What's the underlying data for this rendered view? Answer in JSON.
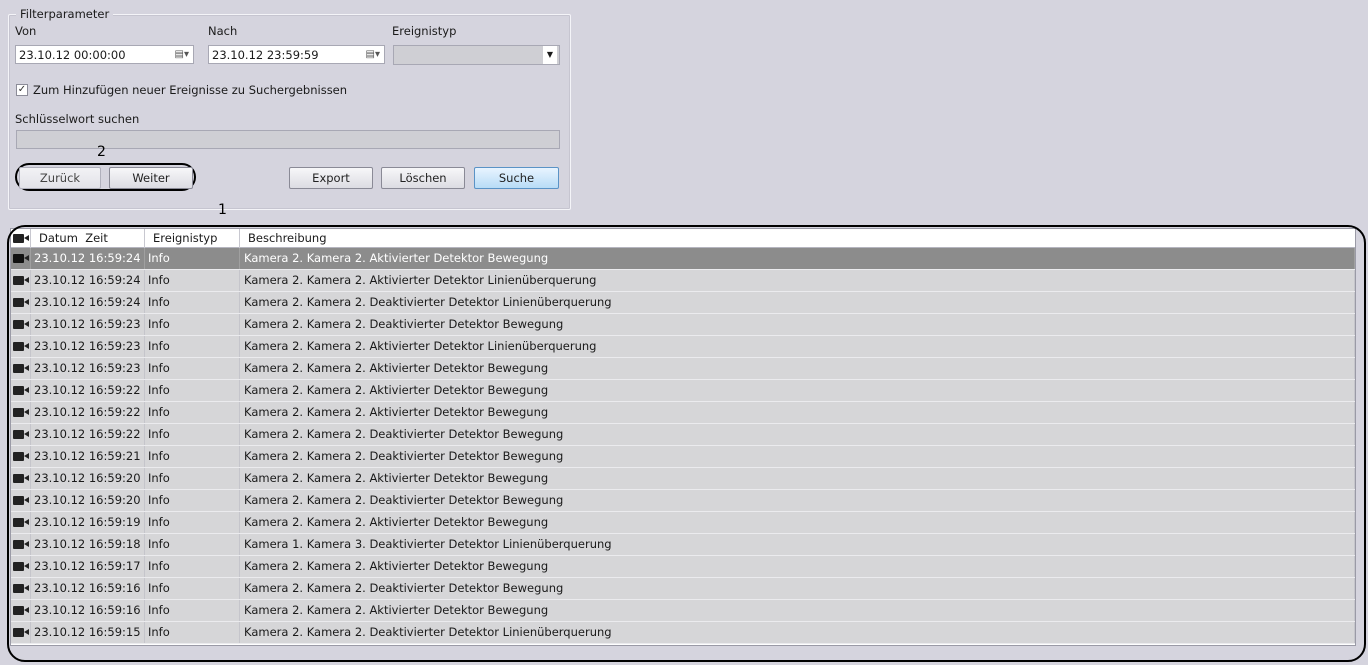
{
  "filter": {
    "legend": "Filterparameter",
    "from_label": "Von",
    "from_value": "23.10.12 00:00:00",
    "to_label": "Nach",
    "to_value": "23.10.12 23:59:59",
    "eventtype_label": "Ereignistyp",
    "eventtype_value": "",
    "checkbox_label": "Zum Hinzufügen neuer Ereignisse zu Suchergebnissen",
    "checkbox_checked": true,
    "keyword_label": "Schlüsselwort suchen",
    "keyword_value": ""
  },
  "buttons": {
    "back": "Zurück",
    "next": "Weiter",
    "export": "Export",
    "clear": "Löschen",
    "search": "Suche"
  },
  "callouts": {
    "one": "1",
    "two": "2"
  },
  "table": {
    "headers": [
      "Datum",
      "Zeit",
      "Ereignistyp",
      "Beschreibung"
    ],
    "rows": [
      {
        "datetime": "23.10.12 16:59:24",
        "type": "Info",
        "desc": "Kamera 2. Kamera 2. Aktivierter Detektor Bewegung"
      },
      {
        "datetime": "23.10.12 16:59:24",
        "type": "Info",
        "desc": "Kamera 2. Kamera 2. Aktivierter Detektor Linienüberquerung"
      },
      {
        "datetime": "23.10.12 16:59:24",
        "type": "Info",
        "desc": "Kamera 2. Kamera 2. Deaktivierter Detektor Linienüberquerung"
      },
      {
        "datetime": "23.10.12 16:59:23",
        "type": "Info",
        "desc": "Kamera 2. Kamera 2. Deaktivierter Detektor Bewegung"
      },
      {
        "datetime": "23.10.12 16:59:23",
        "type": "Info",
        "desc": "Kamera 2. Kamera 2. Aktivierter Detektor Linienüberquerung"
      },
      {
        "datetime": "23.10.12 16:59:23",
        "type": "Info",
        "desc": "Kamera 2. Kamera 2. Aktivierter Detektor Bewegung"
      },
      {
        "datetime": "23.10.12 16:59:22",
        "type": "Info",
        "desc": "Kamera 2. Kamera 2. Aktivierter Detektor Bewegung"
      },
      {
        "datetime": "23.10.12 16:59:22",
        "type": "Info",
        "desc": "Kamera 2. Kamera 2. Aktivierter Detektor Bewegung"
      },
      {
        "datetime": "23.10.12 16:59:22",
        "type": "Info",
        "desc": "Kamera 2. Kamera 2. Deaktivierter Detektor Bewegung"
      },
      {
        "datetime": "23.10.12 16:59:21",
        "type": "Info",
        "desc": "Kamera 2. Kamera 2. Deaktivierter Detektor Bewegung"
      },
      {
        "datetime": "23.10.12 16:59:20",
        "type": "Info",
        "desc": "Kamera 2. Kamera 2. Aktivierter Detektor Bewegung"
      },
      {
        "datetime": "23.10.12 16:59:20",
        "type": "Info",
        "desc": "Kamera 2. Kamera 2. Deaktivierter Detektor Bewegung"
      },
      {
        "datetime": "23.10.12 16:59:19",
        "type": "Info",
        "desc": "Kamera 2. Kamera 2. Aktivierter Detektor Bewegung"
      },
      {
        "datetime": "23.10.12 16:59:18",
        "type": "Info",
        "desc": "Kamera 1. Kamera 3. Deaktivierter Detektor Linienüberquerung"
      },
      {
        "datetime": "23.10.12 16:59:17",
        "type": "Info",
        "desc": "Kamera 2. Kamera 2. Aktivierter Detektor Bewegung"
      },
      {
        "datetime": "23.10.12 16:59:16",
        "type": "Info",
        "desc": "Kamera 2. Kamera 2. Deaktivierter Detektor Bewegung"
      },
      {
        "datetime": "23.10.12 16:59:16",
        "type": "Info",
        "desc": "Kamera 2. Kamera 2. Aktivierter Detektor Bewegung"
      },
      {
        "datetime": "23.10.12 16:59:15",
        "type": "Info",
        "desc": "Kamera 2. Kamera 2. Deaktivierter Detektor Linienüberquerung"
      }
    ],
    "selected_row": 0
  },
  "icons": {
    "camera": "camera-icon",
    "calendar": "calendar-icon",
    "dropdown": "chevron-down-icon"
  },
  "colors": {
    "background": "#d5d4de",
    "selected_row": "#8c8c8c",
    "row": "#d6d6d8",
    "search_button": "#b8dcf6"
  }
}
